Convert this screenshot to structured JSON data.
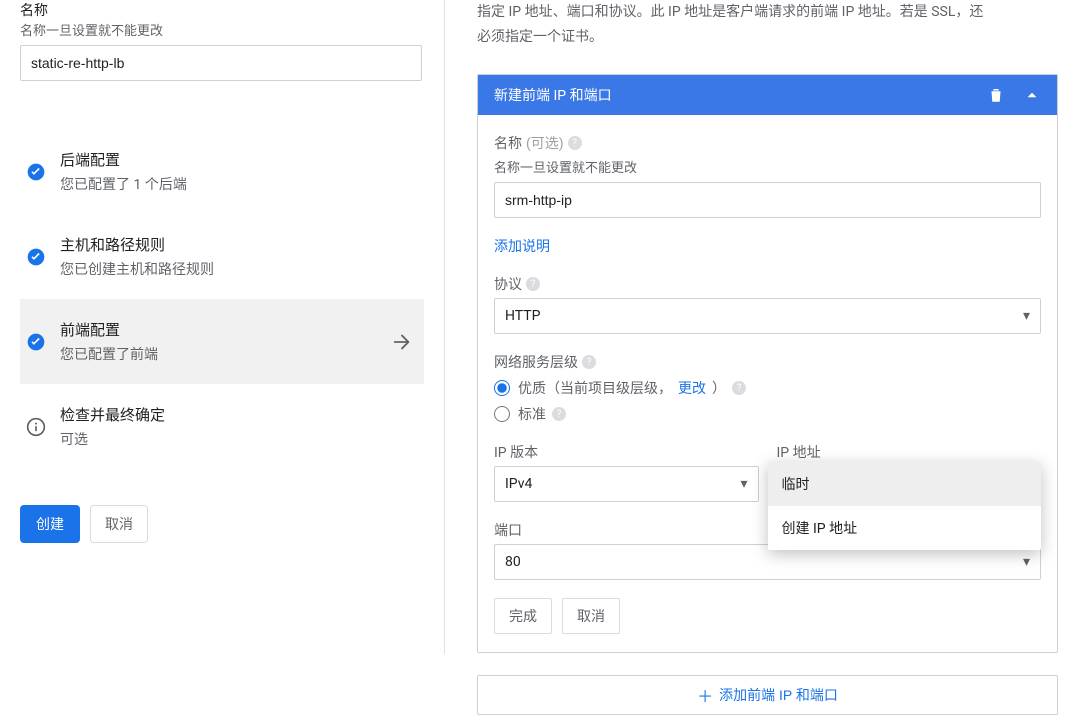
{
  "left": {
    "name_label": "名称",
    "name_hint": "名称一旦设置就不能更改",
    "name_value": "static-re-http-lb",
    "steps": [
      {
        "title": "后端配置",
        "sub": "您已配置了 1 个后端",
        "icon": "check"
      },
      {
        "title": "主机和路径规则",
        "sub": "您已创建主机和路径规则",
        "icon": "check"
      },
      {
        "title": "前端配置",
        "sub": "您已配置了前端",
        "icon": "check"
      },
      {
        "title": "检查并最终确定",
        "sub": "可选",
        "icon": "info"
      }
    ],
    "create_label": "创建",
    "cancel_label": "取消"
  },
  "right": {
    "intro_line1": "指定 IP 地址、端口和协议。此 IP 地址是客户端请求的前端 IP 地址。若是 SSL，还",
    "intro_line2": "必须指定一个证书。",
    "panel_title": "新建前端 IP 和端口",
    "form": {
      "name_label": "名称",
      "name_optional": "(可选)",
      "name_hint": "名称一旦设置就不能更改",
      "name_value": "srm-http-ip",
      "add_desc": "添加说明",
      "protocol_label": "协议",
      "protocol_value": "HTTP",
      "tier_label": "网络服务层级",
      "tier_premium": "优质（当前项目级层级，",
      "tier_change": "更改",
      "tier_premium_suffix": "）",
      "tier_standard": "标准",
      "ip_version_label": "IP 版本",
      "ip_version_value": "IPv4",
      "ip_addr_label": "IP 地址",
      "ip_addr_options": [
        "临时",
        "创建 IP 地址"
      ],
      "port_label": "端口",
      "port_value": "80",
      "done_label": "完成",
      "cancel_label": "取消"
    },
    "add_frontend": "添加前端 IP 和端口"
  }
}
